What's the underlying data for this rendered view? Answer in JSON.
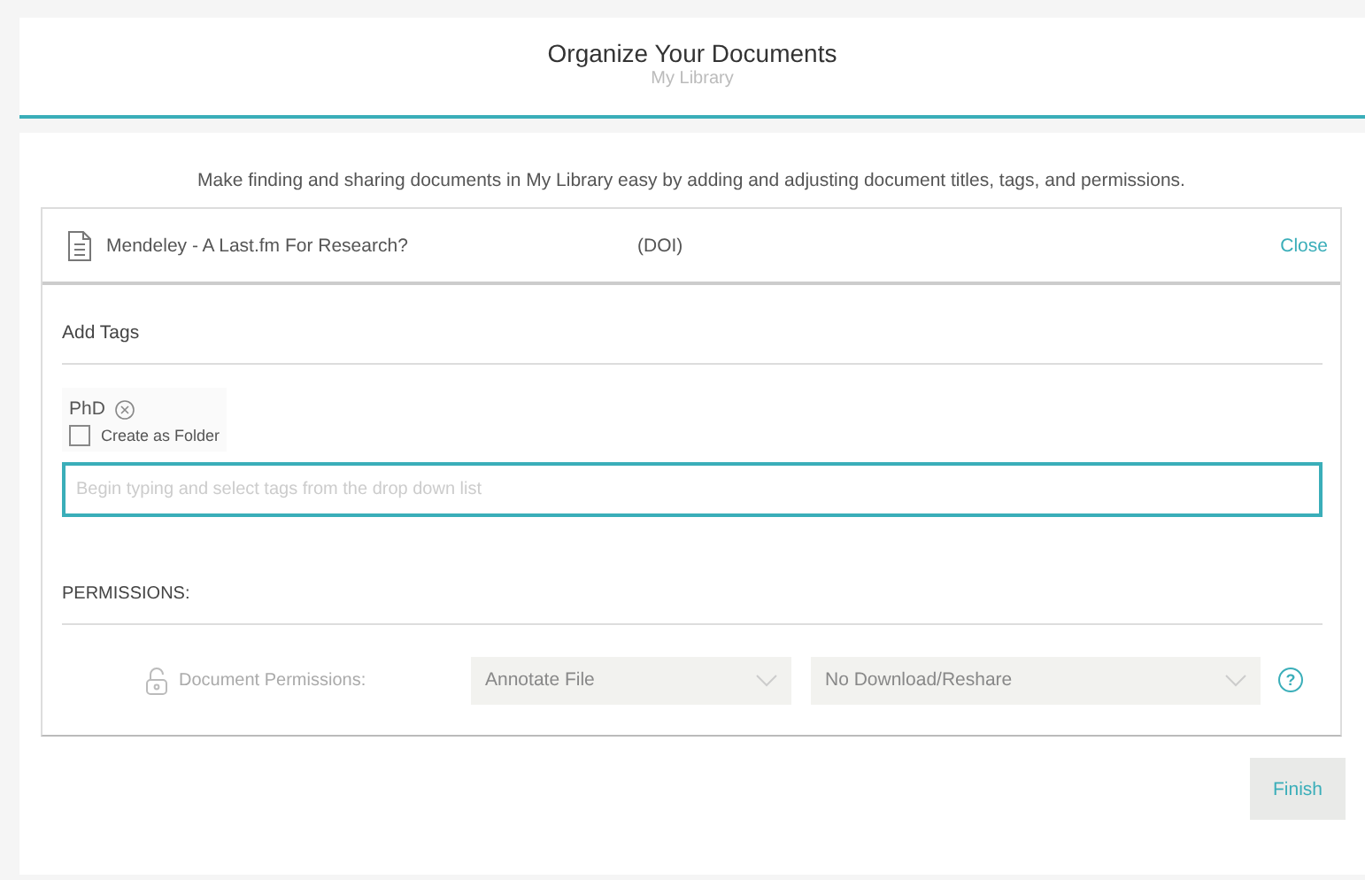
{
  "header": {
    "title": "Organize Your Documents",
    "subtitle": "My Library"
  },
  "intro": "Make finding and sharing documents in My Library easy by adding and adjusting document titles, tags, and permissions.",
  "document": {
    "title": "Mendeley - A Last.fm For Research?",
    "doi": "(DOI)",
    "close": "Close"
  },
  "tags": {
    "heading": "Add Tags",
    "items": [
      {
        "label": "PhD",
        "create_as_folder": {
          "label": "Create as Folder",
          "checked": false
        }
      }
    ],
    "placeholder": "Begin typing and select tags from the drop down list"
  },
  "permissions": {
    "heading": "PERMISSIONS:",
    "label": "Document Permissions:",
    "selects": [
      {
        "value": "Annotate File"
      },
      {
        "value": "No Download/Reshare"
      }
    ],
    "help": "?"
  },
  "buttons": {
    "finish": "Finish"
  }
}
